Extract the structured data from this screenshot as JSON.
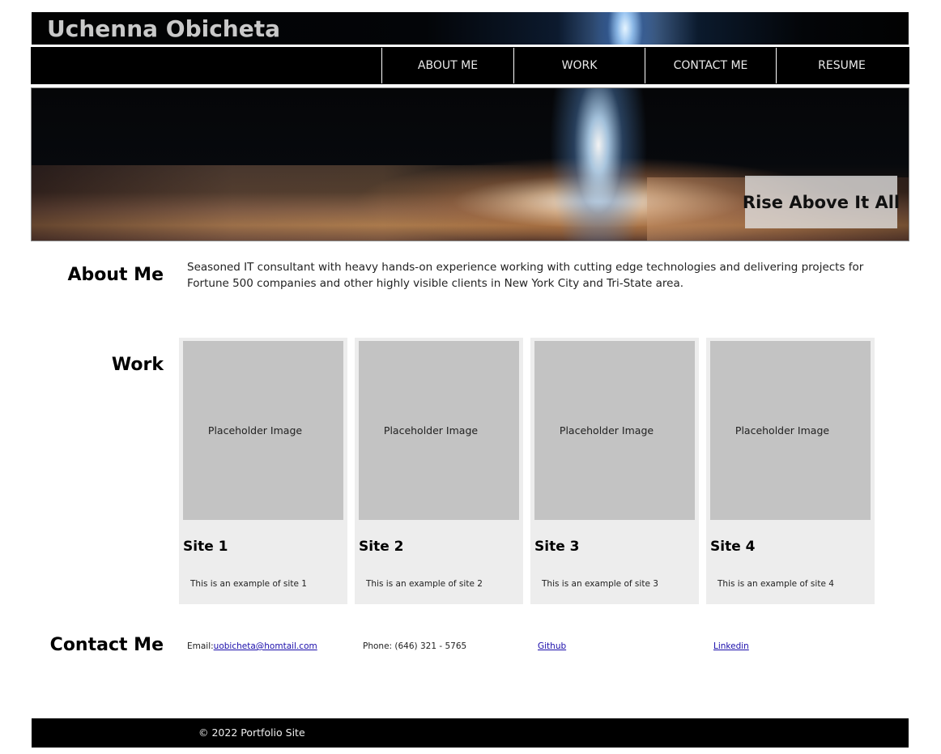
{
  "header": {
    "title": "Uchenna Obicheta"
  },
  "nav": {
    "items": [
      "ABOUT ME",
      "WORK",
      "CONTACT ME",
      "RESUME"
    ]
  },
  "hero": {
    "tagline": "Rise Above It All"
  },
  "about": {
    "heading": "About Me",
    "text": "Seasoned IT consultant with heavy hands-on experience working with cutting edge technologies and delivering projects for Fortune 500 companies and other highly visible clients in New York City and Tri-State area."
  },
  "work": {
    "heading": "Work",
    "items": [
      {
        "placeholder": "Placeholder Image",
        "title": "Site 1",
        "description": "This is an example of site 1"
      },
      {
        "placeholder": "Placeholder Image",
        "title": "Site 2",
        "description": "This is an example of site 2"
      },
      {
        "placeholder": "Placeholder Image",
        "title": "Site 3",
        "description": "This is an example of site 3"
      },
      {
        "placeholder": "Placeholder Image",
        "title": "Site 4",
        "description": "This is an example of site 4"
      }
    ]
  },
  "contact": {
    "heading": "Contact Me",
    "email_label": "Email:",
    "email": "uobicheta@homtail.com",
    "phone": "Phone: (646) 321 - 5765",
    "github": "Github",
    "linkedin": "Linkedin"
  },
  "footer": {
    "copyright": "© 2022 Portfolio Site"
  }
}
